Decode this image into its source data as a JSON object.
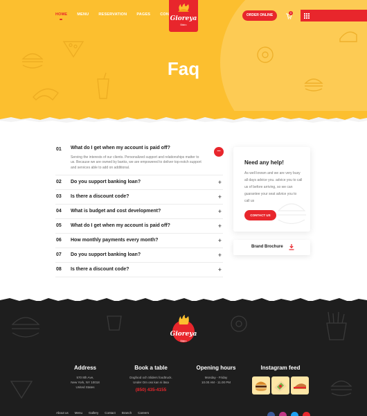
{
  "header": {
    "nav": [
      "Home",
      "Menu",
      "Reservation",
      "Pages",
      "Contact"
    ],
    "logo_name": "Gioreya",
    "logo_sub": "Bistro",
    "order_label": "ORDER ONLINE",
    "cart_count": "0"
  },
  "hero": {
    "title": "Faq"
  },
  "faq": {
    "items": [
      {
        "num": "01",
        "question": "What do I get when my account is paid off?",
        "answer": "Serving the interests of our clients.  Personalized support and relationships matter to us. Because we are owned by banks, we are empowered to deliver top-notch support and services able to add on additional."
      },
      {
        "num": "02",
        "question": "Do you support banking loan?"
      },
      {
        "num": "03",
        "question": "Is there a discount code?"
      },
      {
        "num": "04",
        "question": "What is budget and cost development?"
      },
      {
        "num": "05",
        "question": "What do I get when my account is paid off?"
      },
      {
        "num": "06",
        "question": "How monthly payments every month?"
      },
      {
        "num": "07",
        "question": "Do you support banking loan?"
      },
      {
        "num": "08",
        "question": "Is there a discount code?"
      }
    ]
  },
  "help": {
    "title": "Need any help!",
    "text": "As well known and we are very busy all days advice you. advice you to call us of before arriving, so we can guarantee your seat advice you to call us",
    "button": "CONTACT US"
  },
  "brochure": {
    "label": "Brand Brochure"
  },
  "footer": {
    "logo_name": "Gioreya",
    "logo_sub": "Bistro",
    "address": {
      "title": "Address",
      "lines": [
        "570 8th Ave,",
        "New York, NY 10018",
        "United States"
      ]
    },
    "book": {
      "title": "Book a table",
      "lines": [
        "Dogfood och Sliders foodtruck.",
        "Under Om oss kan ni läsa"
      ],
      "phone": "(850) 435-4155"
    },
    "hours": {
      "title": "Opening hours",
      "lines": [
        "Monday - Friday",
        "10.00 AM - 11.00 PM"
      ]
    },
    "instagram": {
      "title": "Instagram feed"
    },
    "links": [
      "About us",
      "Menu",
      "Gallery",
      "Contact",
      "Branch",
      "Careers"
    ]
  },
  "colors": {
    "accent": "#e8262c",
    "hero": "#fcbf2f",
    "footer": "#1e1e1e",
    "social": [
      "#3b5998",
      "#c13584",
      "#1da1f2",
      "#e8262c"
    ]
  }
}
